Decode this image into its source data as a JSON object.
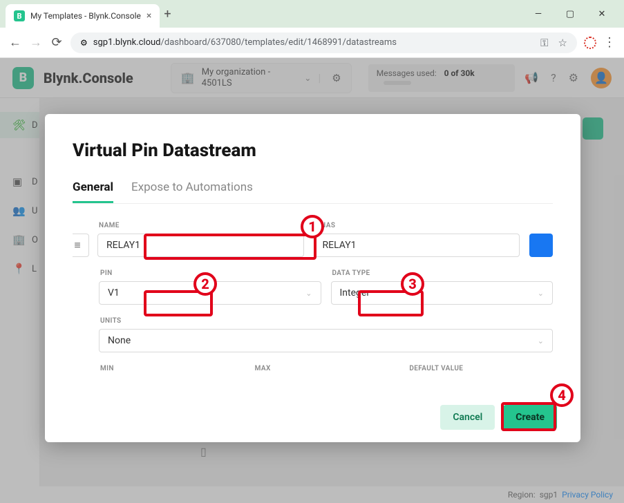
{
  "browser": {
    "tab_title": "My Templates - Blynk.Console",
    "url_host": "sgp1.blynk.cloud",
    "url_path": "/dashboard/637080/templates/edit/1468991/datastreams"
  },
  "app": {
    "logo_letter": "B",
    "logo_text": "Blynk.Console",
    "org_name": "My organization - 4501LS",
    "messages_label": "Messages used:",
    "messages_value": "0 of 30k"
  },
  "sidebar": {
    "items": [
      {
        "icon": "✕",
        "label": "D"
      },
      {
        "icon": "▢",
        "label": "D"
      },
      {
        "icon": "👥",
        "label": "U"
      },
      {
        "icon": "🏢",
        "label": "O"
      },
      {
        "icon": "📍",
        "label": "L"
      }
    ]
  },
  "modal": {
    "title": "Virtual Pin Datastream",
    "tabs": {
      "general": "General",
      "expose": "Expose to Automations"
    },
    "labels": {
      "name": "NAME",
      "alias": "ALIAS",
      "pin": "PIN",
      "data_type": "DATA TYPE",
      "units": "UNITS",
      "min": "MIN",
      "max": "MAX",
      "default_value": "DEFAULT VALUE"
    },
    "values": {
      "name": "RELAY1",
      "alias": "RELAY1",
      "pin": "V1",
      "data_type": "Integer",
      "units": "None"
    },
    "buttons": {
      "cancel": "Cancel",
      "create": "Create"
    }
  },
  "footer": {
    "region_label": "Region:",
    "region": "sgp1",
    "privacy": "Privacy Policy"
  },
  "annotations": {
    "n1": "1",
    "n2": "2",
    "n3": "3",
    "n4": "4"
  }
}
